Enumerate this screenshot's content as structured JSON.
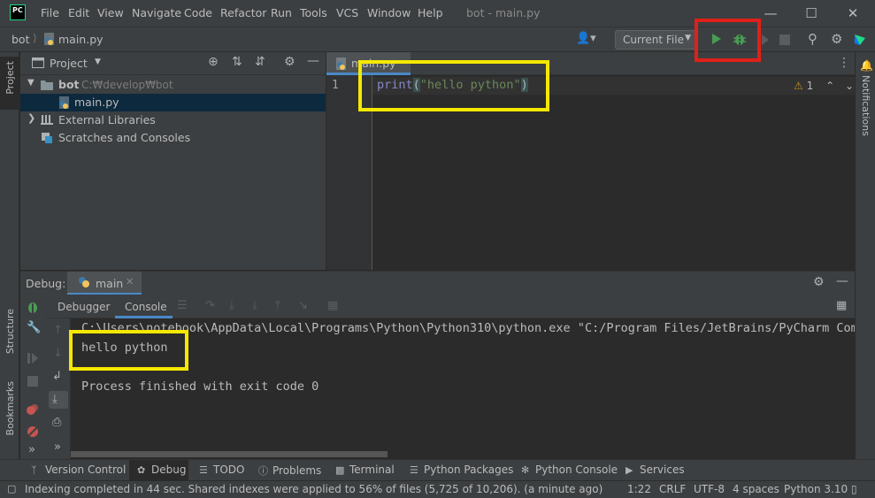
{
  "window": {
    "logo_text": "PC",
    "title": "bot - main.py",
    "menu": [
      "File",
      "Edit",
      "View",
      "Navigate",
      "Code",
      "Refactor",
      "Run",
      "Tools",
      "VCS",
      "Window",
      "Help"
    ]
  },
  "navbar": {
    "project": "bot",
    "file": "main.py",
    "run_config": "Current File"
  },
  "project_panel": {
    "title": "Project",
    "tree": [
      {
        "label": "bot",
        "path": "C:₩develop₩bot"
      },
      {
        "label": "main.py"
      },
      {
        "label": "External Libraries"
      },
      {
        "label": "Scratches and Consoles"
      }
    ]
  },
  "left_stripe": {
    "project": "Project",
    "structure": "Structure",
    "bookmarks": "Bookmarks"
  },
  "right_stripe": {
    "notifications": "Notifications"
  },
  "editor": {
    "tab": "main.py",
    "line_number": "1",
    "code": {
      "fn": "print",
      "open": "(",
      "str": "\"hello python\"",
      "close": ")"
    },
    "warnings": "1"
  },
  "debug": {
    "label": "Debug:",
    "session_tab": "main",
    "subtabs": [
      "Debugger",
      "Console"
    ],
    "console_lines": {
      "command": "C:\\Users\\notebook\\AppData\\Local\\Programs\\Python\\Python310\\python.exe \"C:/Program Files/JetBrains/PyCharm Commu",
      "output": "hello python",
      "exit": "Process finished with exit code 0"
    }
  },
  "bottom_tabs": [
    "Version Control",
    "Debug",
    "TODO",
    "Problems",
    "Terminal",
    "Python Packages",
    "Python Console",
    "Services"
  ],
  "status": {
    "message": "Indexing completed in 44 sec. Shared indexes were applied to 56% of files (5,725 of 10,206). (a minute ago)",
    "position": "1:22",
    "line_sep": "CRLF",
    "encoding": "UTF-8",
    "indent": "4 spaces",
    "interpreter": "Python 3.10"
  },
  "colors": {
    "highlight_run_debug": "#e0201a",
    "highlight_code_output": "#f5e800",
    "run_green": "#499c54"
  }
}
